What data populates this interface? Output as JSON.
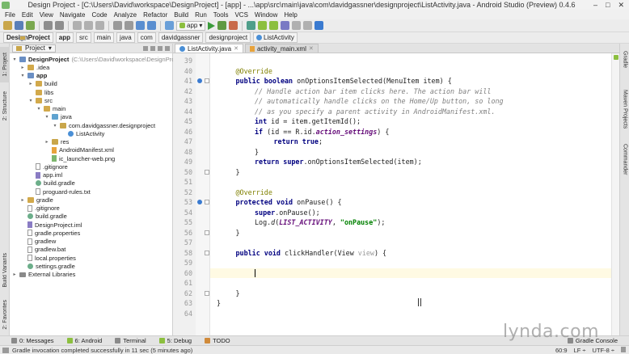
{
  "window": {
    "title": "Design Project - [C:\\Users\\David\\workspace\\DesignProject] - [app] - ...\\app\\src\\main\\java\\com\\davidgassner\\designproject\\ListActivity.java - Android Studio (Preview) 0.4.6",
    "controls": [
      "–",
      "□",
      "✕"
    ]
  },
  "menu": [
    "File",
    "Edit",
    "View",
    "Navigate",
    "Code",
    "Analyze",
    "Refactor",
    "Build",
    "Run",
    "Tools",
    "VCS",
    "Window",
    "Help"
  ],
  "toolbar": {
    "run_config": "app"
  },
  "breadcrumb": [
    "DesignProject",
    "app",
    "src",
    "main",
    "java",
    "com",
    "davidgassner",
    "designproject",
    "ListActivity"
  ],
  "left_stripe": [
    "1: Project",
    "2: Structure",
    "Build Variants",
    "2: Favorites"
  ],
  "right_stripe": [
    "Gradle",
    "Maven Projects",
    "Commander"
  ],
  "project_panel": {
    "view": "Project",
    "tree": [
      {
        "label": "DesignProject",
        "suffix": "(C:\\Users\\David\\workspace\\DesignProject)",
        "depth": 0,
        "icon": "module-folder",
        "arrow": "▾",
        "bold": true
      },
      {
        "label": ".idea",
        "depth": 1,
        "icon": "folder",
        "arrow": "▸"
      },
      {
        "label": "app",
        "depth": 1,
        "icon": "module-folder",
        "arrow": "▾",
        "bold": true
      },
      {
        "label": "build",
        "depth": 2,
        "icon": "folder",
        "arrow": "▸"
      },
      {
        "label": "libs",
        "depth": 2,
        "icon": "folder",
        "arrow": ""
      },
      {
        "label": "src",
        "depth": 2,
        "icon": "folder",
        "arrow": "▾"
      },
      {
        "label": "main",
        "depth": 3,
        "icon": "folder",
        "arrow": "▾"
      },
      {
        "label": "java",
        "depth": 4,
        "icon": "source-folder",
        "arrow": "▾"
      },
      {
        "label": "com.davidgassner.designproject",
        "depth": 5,
        "icon": "package",
        "arrow": "▾"
      },
      {
        "label": "ListActivity",
        "depth": 6,
        "icon": "class",
        "arrow": ""
      },
      {
        "label": "res",
        "depth": 4,
        "icon": "res-folder",
        "arrow": "▸"
      },
      {
        "label": "AndroidManifest.xml",
        "depth": 4,
        "icon": "xml-file",
        "arrow": ""
      },
      {
        "label": "ic_launcher-web.png",
        "depth": 4,
        "icon": "png-file",
        "arrow": ""
      },
      {
        "label": ".gitignore",
        "depth": 2,
        "icon": "text-file",
        "arrow": ""
      },
      {
        "label": "app.iml",
        "depth": 2,
        "icon": "iml-file",
        "arrow": ""
      },
      {
        "label": "build.gradle",
        "depth": 2,
        "icon": "gradle-file",
        "arrow": ""
      },
      {
        "label": "proguard-rules.txt",
        "depth": 2,
        "icon": "text-file",
        "arrow": ""
      },
      {
        "label": "gradle",
        "depth": 1,
        "icon": "folder",
        "arrow": "▸"
      },
      {
        "label": ".gitignore",
        "depth": 1,
        "icon": "text-file",
        "arrow": ""
      },
      {
        "label": "build.gradle",
        "depth": 1,
        "icon": "gradle-file",
        "arrow": ""
      },
      {
        "label": "DesignProject.iml",
        "depth": 1,
        "icon": "iml-file",
        "arrow": ""
      },
      {
        "label": "gradle.properties",
        "depth": 1,
        "icon": "text-file",
        "arrow": ""
      },
      {
        "label": "gradlew",
        "depth": 1,
        "icon": "text-file",
        "arrow": ""
      },
      {
        "label": "gradlew.bat",
        "depth": 1,
        "icon": "text-file",
        "arrow": ""
      },
      {
        "label": "local.properties",
        "depth": 1,
        "icon": "text-file",
        "arrow": ""
      },
      {
        "label": "settings.gradle",
        "depth": 1,
        "icon": "gradle-file",
        "arrow": ""
      },
      {
        "label": "External Libraries",
        "depth": 0,
        "icon": "library",
        "arrow": "▸"
      }
    ]
  },
  "editor_tabs": [
    {
      "label": "ListActivity.java",
      "icon": "class",
      "active": true
    },
    {
      "label": "activity_main.xml",
      "icon": "xml-file",
      "active": false
    }
  ],
  "code": {
    "current_line": 60,
    "lines": [
      {
        "n": "39",
        "indent": 0,
        "parts": []
      },
      {
        "n": "40",
        "indent": 1,
        "parts": [
          {
            "t": "@Override",
            "c": "an"
          }
        ]
      },
      {
        "n": "41",
        "indent": 1,
        "parts": [
          {
            "t": "public boolean ",
            "c": "kw"
          },
          {
            "t": "onOptionsItemSelected(MenuItem item) {",
            "c": ""
          }
        ]
      },
      {
        "n": "42",
        "indent": 2,
        "parts": [
          {
            "t": "// Handle action bar item clicks here. The action bar will",
            "c": "cm"
          }
        ]
      },
      {
        "n": "43",
        "indent": 2,
        "parts": [
          {
            "t": "// automatically handle clicks on the Home/Up button, so long",
            "c": "cm"
          }
        ]
      },
      {
        "n": "44",
        "indent": 2,
        "parts": [
          {
            "t": "// as you specify a parent activity in AndroidManifest.xml.",
            "c": "cm"
          }
        ]
      },
      {
        "n": "45",
        "indent": 2,
        "parts": [
          {
            "t": "int ",
            "c": "kw"
          },
          {
            "t": "id = item.getItemId();",
            "c": ""
          }
        ]
      },
      {
        "n": "46",
        "indent": 2,
        "parts": [
          {
            "t": "if ",
            "c": "kw"
          },
          {
            "t": "(id == R.id.",
            "c": ""
          },
          {
            "t": "action_settings",
            "c": "fi"
          },
          {
            "t": ") {",
            "c": ""
          }
        ]
      },
      {
        "n": "47",
        "indent": 3,
        "parts": [
          {
            "t": "return true",
            "c": "kw"
          },
          {
            "t": ";",
            "c": ""
          }
        ]
      },
      {
        "n": "48",
        "indent": 2,
        "parts": [
          {
            "t": "}",
            "c": ""
          }
        ]
      },
      {
        "n": "49",
        "indent": 2,
        "parts": [
          {
            "t": "return super",
            "c": "kw"
          },
          {
            "t": ".onOptionsItemSelected(item);",
            "c": ""
          }
        ]
      },
      {
        "n": "50",
        "indent": 1,
        "parts": [
          {
            "t": "}",
            "c": ""
          }
        ]
      },
      {
        "n": "51",
        "indent": 0,
        "parts": []
      },
      {
        "n": "52",
        "indent": 1,
        "parts": [
          {
            "t": "@Override",
            "c": "an"
          }
        ]
      },
      {
        "n": "53",
        "indent": 1,
        "parts": [
          {
            "t": "protected void ",
            "c": "kw"
          },
          {
            "t": "onPause() {",
            "c": ""
          }
        ]
      },
      {
        "n": "54",
        "indent": 2,
        "parts": [
          {
            "t": "super",
            "c": "kw"
          },
          {
            "t": ".onPause();",
            "c": ""
          }
        ]
      },
      {
        "n": "55",
        "indent": 2,
        "parts": [
          {
            "t": "Log.",
            "c": ""
          },
          {
            "t": "d",
            "c": "it"
          },
          {
            "t": "(",
            "c": ""
          },
          {
            "t": "LIST_ACTIVITY",
            "c": "fi"
          },
          {
            "t": ", ",
            "c": ""
          },
          {
            "t": "\"onPause\"",
            "c": "st"
          },
          {
            "t": ");",
            "c": ""
          }
        ]
      },
      {
        "n": "56",
        "indent": 1,
        "parts": [
          {
            "t": "}",
            "c": ""
          }
        ]
      },
      {
        "n": "57",
        "indent": 0,
        "parts": []
      },
      {
        "n": "58",
        "indent": 1,
        "parts": [
          {
            "t": "public void ",
            "c": "kw"
          },
          {
            "t": "clickHandler(View ",
            "c": ""
          },
          {
            "t": "view",
            "c": "pm"
          },
          {
            "t": ") {",
            "c": ""
          }
        ]
      },
      {
        "n": "59",
        "indent": 0,
        "parts": []
      },
      {
        "n": "60",
        "indent": 0,
        "parts": []
      },
      {
        "n": "61",
        "indent": 0,
        "parts": []
      },
      {
        "n": "62",
        "indent": 1,
        "parts": [
          {
            "t": "}",
            "c": ""
          }
        ]
      },
      {
        "n": "63",
        "indent": 0,
        "parts": [
          {
            "t": "}",
            "c": ""
          }
        ]
      },
      {
        "n": "64",
        "indent": 0,
        "parts": []
      }
    ]
  },
  "bottom_tabs": [
    {
      "label": "0: Messages",
      "icon": "messages-icon"
    },
    {
      "label": "6: Android",
      "icon": "android-icon"
    },
    {
      "label": "Terminal",
      "icon": "terminal-icon"
    },
    {
      "label": "5: Debug",
      "icon": "debug-icon"
    },
    {
      "label": "TODO",
      "icon": "todo-icon"
    },
    {
      "label": "Gradle Console",
      "icon": "gradle-console-icon"
    }
  ],
  "status": {
    "message": "Gradle invocation completed successfully in 11 sec (5 minutes ago)",
    "position": "60:9",
    "line_sep": "LF ÷",
    "encoding": "UTF-8 ÷"
  },
  "watermark": "lynda.com"
}
